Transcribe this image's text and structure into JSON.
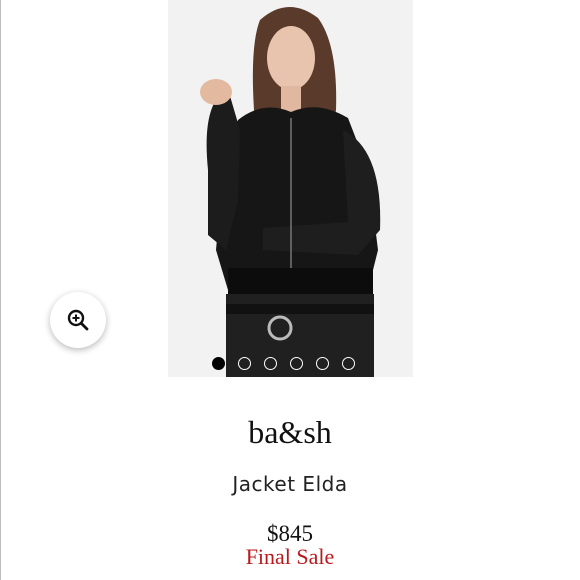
{
  "product": {
    "brand": "ba&sh",
    "name": "Jacket Elda",
    "price": "$845",
    "sale_label": "Final Sale"
  },
  "gallery": {
    "image_count": 6,
    "active_index": 0
  },
  "icons": {
    "zoom": "zoom-in-magnifier-icon"
  },
  "colors": {
    "sale": "#b7191c",
    "active_dot": "#000000",
    "inactive_dot": "#ffffff"
  }
}
